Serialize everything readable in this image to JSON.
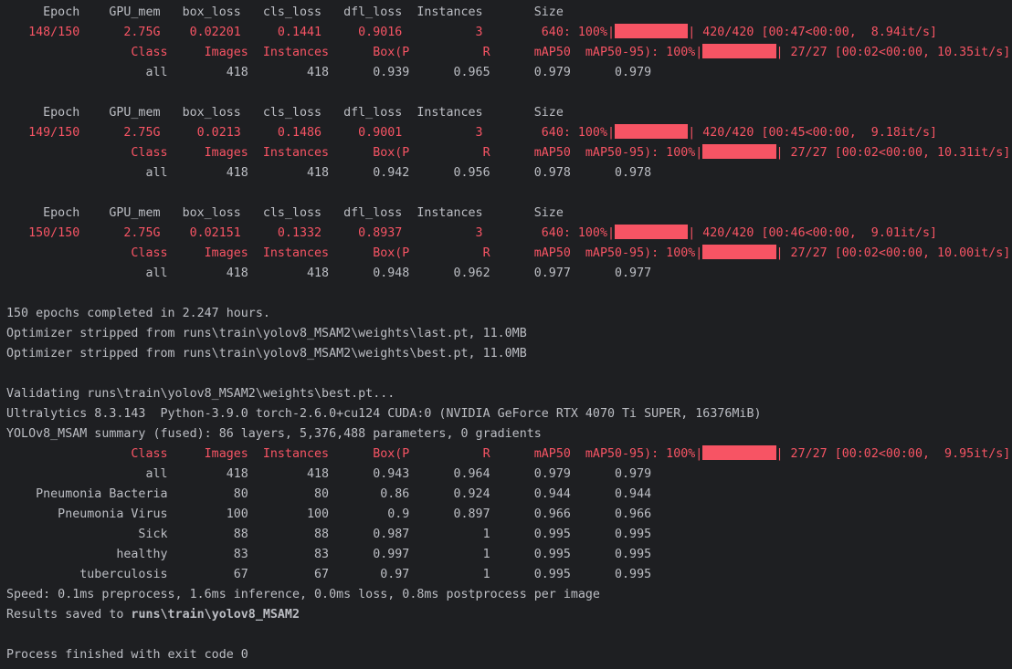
{
  "colors": {
    "background": "#1e1f22",
    "text": "#bcbec4",
    "error_red": "#f75464"
  },
  "lines": [
    {
      "segments": [
        {
          "text": "     Epoch    GPU_mem   box_loss   cls_loss   dfl_loss  Instances       Size"
        }
      ]
    },
    {
      "segments": [
        {
          "text": "   148/150      2.75G    0.02201     0.1441     0.9016          3        640: 100%|",
          "red": true
        },
        {
          "bar": 10
        },
        {
          "text": "| 420/420 [00:47<00:00,  8.94it/s]",
          "red": true
        }
      ]
    },
    {
      "segments": [
        {
          "text": "                 Class     Images  Instances      Box(P          R      mAP50  mAP50-95): 100%|",
          "red": true
        },
        {
          "bar": 10
        },
        {
          "text": "| 27/27 [00:02<00:00, 10.35it/s]",
          "red": true
        }
      ]
    },
    {
      "segments": [
        {
          "text": "                   all        418        418      0.939      0.965      0.979      0.979"
        }
      ]
    },
    {
      "segments": [
        {
          "text": ""
        }
      ]
    },
    {
      "segments": [
        {
          "text": "     Epoch    GPU_mem   box_loss   cls_loss   dfl_loss  Instances       Size"
        }
      ]
    },
    {
      "segments": [
        {
          "text": "   149/150      2.75G     0.0213     0.1486     0.9001          3        640: 100%|",
          "red": true
        },
        {
          "bar": 10
        },
        {
          "text": "| 420/420 [00:45<00:00,  9.18it/s]",
          "red": true
        }
      ]
    },
    {
      "segments": [
        {
          "text": "                 Class     Images  Instances      Box(P          R      mAP50  mAP50-95): 100%|",
          "red": true
        },
        {
          "bar": 10
        },
        {
          "text": "| 27/27 [00:02<00:00, 10.31it/s]",
          "red": true
        }
      ]
    },
    {
      "segments": [
        {
          "text": "                   all        418        418      0.942      0.956      0.978      0.978"
        }
      ]
    },
    {
      "segments": [
        {
          "text": ""
        }
      ]
    },
    {
      "segments": [
        {
          "text": "     Epoch    GPU_mem   box_loss   cls_loss   dfl_loss  Instances       Size"
        }
      ]
    },
    {
      "segments": [
        {
          "text": "   150/150      2.75G    0.02151     0.1332     0.8937          3        640: 100%|",
          "red": true
        },
        {
          "bar": 10
        },
        {
          "text": "| 420/420 [00:46<00:00,  9.01it/s]",
          "red": true
        }
      ]
    },
    {
      "segments": [
        {
          "text": "                 Class     Images  Instances      Box(P          R      mAP50  mAP50-95): 100%|",
          "red": true
        },
        {
          "bar": 10
        },
        {
          "text": "| 27/27 [00:02<00:00, 10.00it/s]",
          "red": true
        }
      ]
    },
    {
      "segments": [
        {
          "text": "                   all        418        418      0.948      0.962      0.977      0.977"
        }
      ]
    },
    {
      "segments": [
        {
          "text": ""
        }
      ]
    },
    {
      "segments": [
        {
          "text": "150 epochs completed in 2.247 hours."
        }
      ]
    },
    {
      "segments": [
        {
          "text": "Optimizer stripped from runs\\train\\yolov8_MSAM2\\weights\\last.pt, 11.0MB"
        }
      ]
    },
    {
      "segments": [
        {
          "text": "Optimizer stripped from runs\\train\\yolov8_MSAM2\\weights\\best.pt, 11.0MB"
        }
      ]
    },
    {
      "segments": [
        {
          "text": ""
        }
      ]
    },
    {
      "segments": [
        {
          "text": "Validating runs\\train\\yolov8_MSAM2\\weights\\best.pt..."
        }
      ]
    },
    {
      "segments": [
        {
          "text": "Ultralytics 8.3.143  Python-3.9.0 torch-2.6.0+cu124 CUDA:0 (NVIDIA GeForce RTX 4070 Ti SUPER, 16376MiB)"
        }
      ]
    },
    {
      "segments": [
        {
          "text": "YOLOv8_MSAM summary (fused): 86 layers, 5,376,488 parameters, 0 gradients"
        }
      ]
    },
    {
      "segments": [
        {
          "text": "                 Class     Images  Instances      Box(P          R      mAP50  mAP50-95): 100%|",
          "red": true
        },
        {
          "bar": 10
        },
        {
          "text": "| 27/27 [00:02<00:00,  9.95it/s]",
          "red": true
        }
      ]
    },
    {
      "segments": [
        {
          "text": "                   all        418        418      0.943      0.964      0.979      0.979"
        }
      ]
    },
    {
      "segments": [
        {
          "text": "    Pneumonia Bacteria         80         80       0.86      0.924      0.944      0.944"
        }
      ]
    },
    {
      "segments": [
        {
          "text": "       Pneumonia Virus        100        100        0.9      0.897      0.966      0.966"
        }
      ]
    },
    {
      "segments": [
        {
          "text": "                  Sick         88         88      0.987          1      0.995      0.995"
        }
      ]
    },
    {
      "segments": [
        {
          "text": "               healthy         83         83      0.997          1      0.995      0.995"
        }
      ]
    },
    {
      "segments": [
        {
          "text": "          tuberculosis         67         67       0.97          1      0.995      0.995"
        }
      ]
    },
    {
      "segments": [
        {
          "text": "Speed: 0.1ms preprocess, 1.6ms inference, 0.0ms loss, 0.8ms postprocess per image"
        }
      ]
    },
    {
      "segments": [
        {
          "text": "Results saved to "
        },
        {
          "text": "runs\\train\\yolov8_MSAM2",
          "bold": true
        }
      ]
    },
    {
      "segments": [
        {
          "text": ""
        }
      ]
    },
    {
      "segments": [
        {
          "text": "Process finished with exit code 0"
        }
      ]
    }
  ]
}
